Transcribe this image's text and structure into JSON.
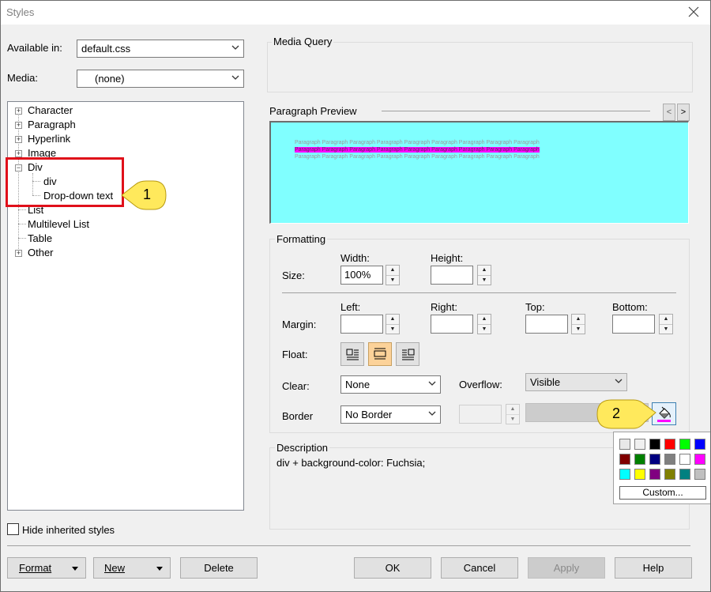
{
  "window": {
    "title": "Styles"
  },
  "left": {
    "available_label": "Available in:",
    "available_value": "default.css",
    "media_label": "Media:",
    "media_value": "(none)",
    "hide_inherited_label": "Hide inherited styles",
    "hide_inherited_checked": false
  },
  "tree": {
    "items": [
      {
        "label": "Character",
        "expander": "+",
        "level": 0
      },
      {
        "label": "Paragraph",
        "expander": "+",
        "level": 0
      },
      {
        "label": "Hyperlink",
        "expander": "+",
        "level": 0
      },
      {
        "label": "Image",
        "expander": "+",
        "level": 0
      },
      {
        "label": "Div",
        "expander": "−",
        "level": 0
      },
      {
        "label": "div",
        "expander": "",
        "level": 1
      },
      {
        "label": "Drop-down text",
        "expander": "",
        "level": 1,
        "selected": true
      },
      {
        "label": "List",
        "expander": "",
        "level": 0
      },
      {
        "label": "Multilevel List",
        "expander": "",
        "level": 0
      },
      {
        "label": "Table",
        "expander": "",
        "level": 0
      },
      {
        "label": "Other",
        "expander": "+",
        "level": 0
      }
    ]
  },
  "callouts": {
    "one": "1",
    "two": "2"
  },
  "media_query": {
    "label": "Media Query"
  },
  "preview": {
    "label": "Paragraph Preview",
    "prev_arrow": "<",
    "next_arrow": ">",
    "sample_text": "Paragraph Paragraph Paragraph Paragraph Paragraph Paragraph Paragraph Paragraph Paragraph",
    "highlight_color": "#ff00ff",
    "background_color": "#80ffff"
  },
  "formatting": {
    "label": "Formatting",
    "size_label": "Size:",
    "width_label": "Width:",
    "width_value": "100%",
    "height_label": "Height:",
    "height_value": "",
    "margin_label": "Margin:",
    "left_label": "Left:",
    "right_label": "Right:",
    "top_label": "Top:",
    "bottom_label": "Bottom:",
    "left_value": "",
    "right_value": "",
    "top_value": "",
    "bottom_value": "",
    "float_label": "Float:",
    "float_selected": "none",
    "clear_label": "Clear:",
    "clear_value": "None",
    "overflow_label": "Overflow:",
    "overflow_value": "Visible",
    "border_label": "Border",
    "border_value": "No Border",
    "border_width_value": "",
    "fill_color": "#ff00ff"
  },
  "description": {
    "label": "Description",
    "text": "div + background-color: Fuchsia;"
  },
  "palette": {
    "colors": [
      "#e8e8e8",
      "#f0f0f0",
      "#000000",
      "#ff0000",
      "#00ff00",
      "#0000ff",
      "#800000",
      "#008000",
      "#000080",
      "#808080",
      "#ffffff",
      "#ff00ff",
      "#00ffff",
      "#ffff00",
      "#800080",
      "#808000",
      "#008080",
      "#c0c0c0"
    ],
    "custom_label": "Custom..."
  },
  "buttons": {
    "format": "Format",
    "new": "New",
    "delete": "Delete",
    "ok": "OK",
    "cancel": "Cancel",
    "apply": "Apply",
    "help": "Help"
  }
}
